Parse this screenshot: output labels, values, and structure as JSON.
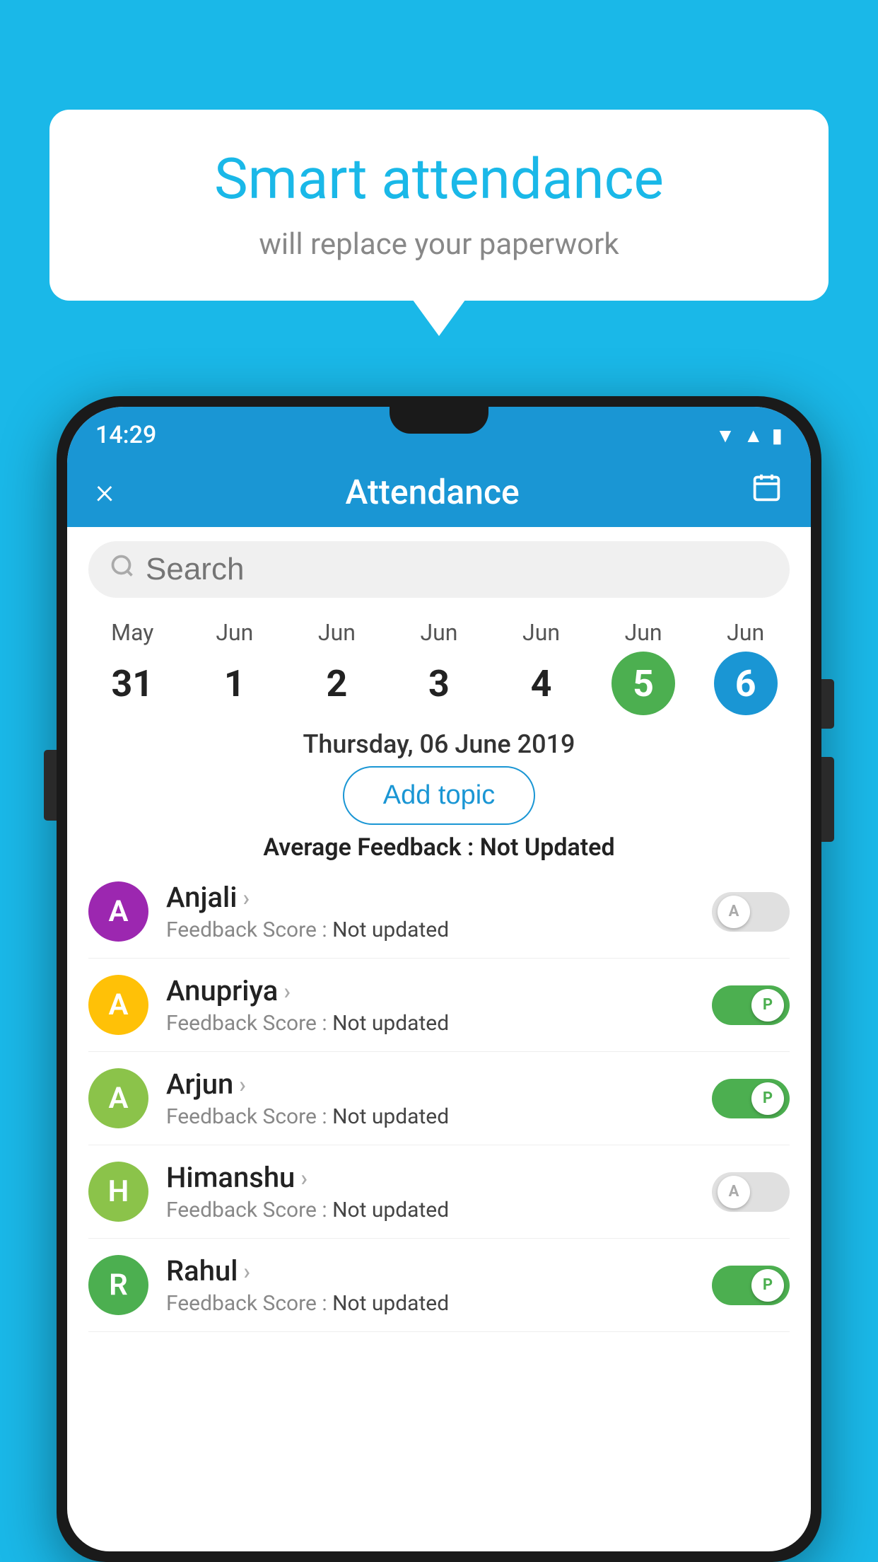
{
  "background_color": "#1ab8e8",
  "speech_bubble": {
    "title": "Smart attendance",
    "subtitle": "will replace your paperwork"
  },
  "status_bar": {
    "time": "14:29",
    "icons": [
      "wifi",
      "signal",
      "battery"
    ]
  },
  "app_header": {
    "title": "Attendance",
    "close_label": "×",
    "calendar_icon": "📅"
  },
  "search": {
    "placeholder": "Search"
  },
  "calendar": {
    "days": [
      {
        "month": "May",
        "date": "31",
        "style": "normal"
      },
      {
        "month": "Jun",
        "date": "1",
        "style": "normal"
      },
      {
        "month": "Jun",
        "date": "2",
        "style": "normal"
      },
      {
        "month": "Jun",
        "date": "3",
        "style": "normal"
      },
      {
        "month": "Jun",
        "date": "4",
        "style": "normal"
      },
      {
        "month": "Jun",
        "date": "5",
        "style": "today"
      },
      {
        "month": "Jun",
        "date": "6",
        "style": "selected"
      }
    ]
  },
  "selected_date": "Thursday, 06 June 2019",
  "add_topic_label": "Add topic",
  "avg_feedback_label": "Average Feedback : ",
  "avg_feedback_value": "Not Updated",
  "students": [
    {
      "name": "Anjali",
      "avatar_letter": "A",
      "avatar_color": "#9c27b0",
      "feedback_label": "Feedback Score : ",
      "feedback_value": "Not updated",
      "attendance": "absent",
      "toggle_label": "A"
    },
    {
      "name": "Anupriya",
      "avatar_letter": "A",
      "avatar_color": "#ffc107",
      "feedback_label": "Feedback Score : ",
      "feedback_value": "Not updated",
      "attendance": "present",
      "toggle_label": "P"
    },
    {
      "name": "Arjun",
      "avatar_letter": "A",
      "avatar_color": "#8bc34a",
      "feedback_label": "Feedback Score : ",
      "feedback_value": "Not updated",
      "attendance": "present",
      "toggle_label": "P"
    },
    {
      "name": "Himanshu",
      "avatar_letter": "H",
      "avatar_color": "#8bc34a",
      "feedback_label": "Feedback Score : ",
      "feedback_value": "Not updated",
      "attendance": "absent",
      "toggle_label": "A"
    },
    {
      "name": "Rahul",
      "avatar_letter": "R",
      "avatar_color": "#4caf50",
      "feedback_label": "Feedback Score : ",
      "feedback_value": "Not updated",
      "attendance": "present",
      "toggle_label": "P"
    }
  ]
}
